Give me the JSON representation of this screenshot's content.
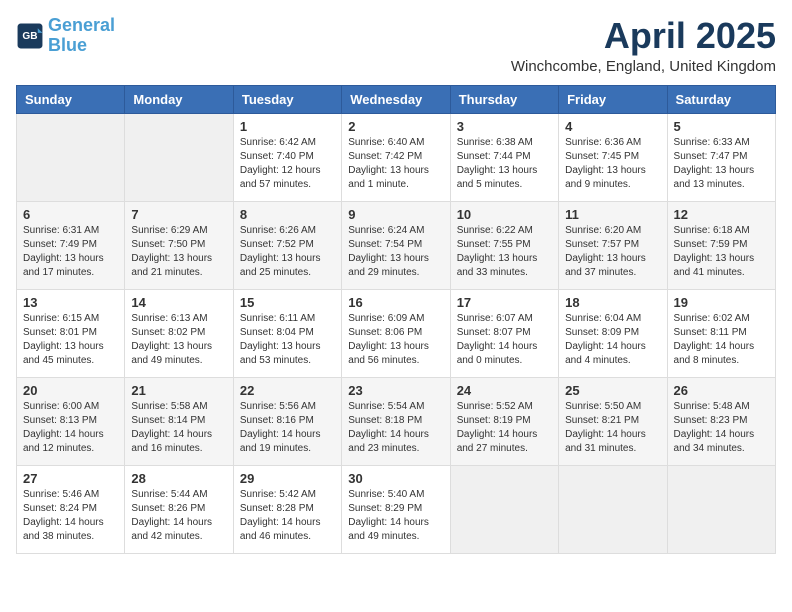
{
  "header": {
    "logo_line1": "General",
    "logo_line2": "Blue",
    "month": "April 2025",
    "location": "Winchcombe, England, United Kingdom"
  },
  "weekdays": [
    "Sunday",
    "Monday",
    "Tuesday",
    "Wednesday",
    "Thursday",
    "Friday",
    "Saturday"
  ],
  "weeks": [
    [
      {
        "day": "",
        "info": ""
      },
      {
        "day": "",
        "info": ""
      },
      {
        "day": "1",
        "info": "Sunrise: 6:42 AM\nSunset: 7:40 PM\nDaylight: 12 hours and 57 minutes."
      },
      {
        "day": "2",
        "info": "Sunrise: 6:40 AM\nSunset: 7:42 PM\nDaylight: 13 hours and 1 minute."
      },
      {
        "day": "3",
        "info": "Sunrise: 6:38 AM\nSunset: 7:44 PM\nDaylight: 13 hours and 5 minutes."
      },
      {
        "day": "4",
        "info": "Sunrise: 6:36 AM\nSunset: 7:45 PM\nDaylight: 13 hours and 9 minutes."
      },
      {
        "day": "5",
        "info": "Sunrise: 6:33 AM\nSunset: 7:47 PM\nDaylight: 13 hours and 13 minutes."
      }
    ],
    [
      {
        "day": "6",
        "info": "Sunrise: 6:31 AM\nSunset: 7:49 PM\nDaylight: 13 hours and 17 minutes."
      },
      {
        "day": "7",
        "info": "Sunrise: 6:29 AM\nSunset: 7:50 PM\nDaylight: 13 hours and 21 minutes."
      },
      {
        "day": "8",
        "info": "Sunrise: 6:26 AM\nSunset: 7:52 PM\nDaylight: 13 hours and 25 minutes."
      },
      {
        "day": "9",
        "info": "Sunrise: 6:24 AM\nSunset: 7:54 PM\nDaylight: 13 hours and 29 minutes."
      },
      {
        "day": "10",
        "info": "Sunrise: 6:22 AM\nSunset: 7:55 PM\nDaylight: 13 hours and 33 minutes."
      },
      {
        "day": "11",
        "info": "Sunrise: 6:20 AM\nSunset: 7:57 PM\nDaylight: 13 hours and 37 minutes."
      },
      {
        "day": "12",
        "info": "Sunrise: 6:18 AM\nSunset: 7:59 PM\nDaylight: 13 hours and 41 minutes."
      }
    ],
    [
      {
        "day": "13",
        "info": "Sunrise: 6:15 AM\nSunset: 8:01 PM\nDaylight: 13 hours and 45 minutes."
      },
      {
        "day": "14",
        "info": "Sunrise: 6:13 AM\nSunset: 8:02 PM\nDaylight: 13 hours and 49 minutes."
      },
      {
        "day": "15",
        "info": "Sunrise: 6:11 AM\nSunset: 8:04 PM\nDaylight: 13 hours and 53 minutes."
      },
      {
        "day": "16",
        "info": "Sunrise: 6:09 AM\nSunset: 8:06 PM\nDaylight: 13 hours and 56 minutes."
      },
      {
        "day": "17",
        "info": "Sunrise: 6:07 AM\nSunset: 8:07 PM\nDaylight: 14 hours and 0 minutes."
      },
      {
        "day": "18",
        "info": "Sunrise: 6:04 AM\nSunset: 8:09 PM\nDaylight: 14 hours and 4 minutes."
      },
      {
        "day": "19",
        "info": "Sunrise: 6:02 AM\nSunset: 8:11 PM\nDaylight: 14 hours and 8 minutes."
      }
    ],
    [
      {
        "day": "20",
        "info": "Sunrise: 6:00 AM\nSunset: 8:13 PM\nDaylight: 14 hours and 12 minutes."
      },
      {
        "day": "21",
        "info": "Sunrise: 5:58 AM\nSunset: 8:14 PM\nDaylight: 14 hours and 16 minutes."
      },
      {
        "day": "22",
        "info": "Sunrise: 5:56 AM\nSunset: 8:16 PM\nDaylight: 14 hours and 19 minutes."
      },
      {
        "day": "23",
        "info": "Sunrise: 5:54 AM\nSunset: 8:18 PM\nDaylight: 14 hours and 23 minutes."
      },
      {
        "day": "24",
        "info": "Sunrise: 5:52 AM\nSunset: 8:19 PM\nDaylight: 14 hours and 27 minutes."
      },
      {
        "day": "25",
        "info": "Sunrise: 5:50 AM\nSunset: 8:21 PM\nDaylight: 14 hours and 31 minutes."
      },
      {
        "day": "26",
        "info": "Sunrise: 5:48 AM\nSunset: 8:23 PM\nDaylight: 14 hours and 34 minutes."
      }
    ],
    [
      {
        "day": "27",
        "info": "Sunrise: 5:46 AM\nSunset: 8:24 PM\nDaylight: 14 hours and 38 minutes."
      },
      {
        "day": "28",
        "info": "Sunrise: 5:44 AM\nSunset: 8:26 PM\nDaylight: 14 hours and 42 minutes."
      },
      {
        "day": "29",
        "info": "Sunrise: 5:42 AM\nSunset: 8:28 PM\nDaylight: 14 hours and 46 minutes."
      },
      {
        "day": "30",
        "info": "Sunrise: 5:40 AM\nSunset: 8:29 PM\nDaylight: 14 hours and 49 minutes."
      },
      {
        "day": "",
        "info": ""
      },
      {
        "day": "",
        "info": ""
      },
      {
        "day": "",
        "info": ""
      }
    ]
  ]
}
